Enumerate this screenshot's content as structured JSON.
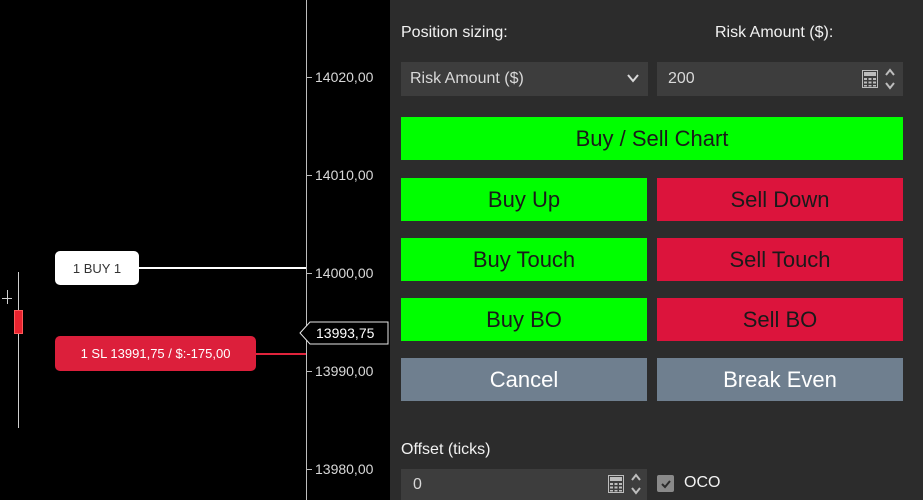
{
  "chart": {
    "ticks": [
      "14020,00",
      "14010,00",
      "14000,00",
      "13990,00",
      "13980,00"
    ],
    "current_price": "13993,75",
    "orders": {
      "buy_label": "1 BUY 1",
      "sl_label": "1 SL 13991,75 / $:-175,00"
    }
  },
  "panel": {
    "position_sizing_label": "Position sizing:",
    "risk_amount_label": "Risk Amount ($):",
    "sizing_select_value": "Risk Amount ($)",
    "risk_amount_value": "200",
    "offset_label": "Offset (ticks)",
    "offset_value": "0",
    "oco_label": "OCO",
    "oco_checked": true
  },
  "buttons": {
    "buy_sell_chart": "Buy / Sell Chart",
    "buy_up": "Buy Up",
    "sell_down": "Sell Down",
    "buy_touch": "Buy Touch",
    "sell_touch": "Sell Touch",
    "buy_bo": "Buy BO",
    "sell_bo": "Sell BO",
    "cancel": "Cancel",
    "break_even": "Break Even"
  },
  "colors": {
    "buy": "#00ff00",
    "sell": "#dc143c",
    "neutral": "#6f7f8f",
    "panel_bg": "#2c2c2c"
  },
  "icons": {
    "calculator": "calculator-icon",
    "spinner": "spinner-arrows-icon",
    "chevron": "chevron-down-icon",
    "check": "checkmark-icon"
  }
}
